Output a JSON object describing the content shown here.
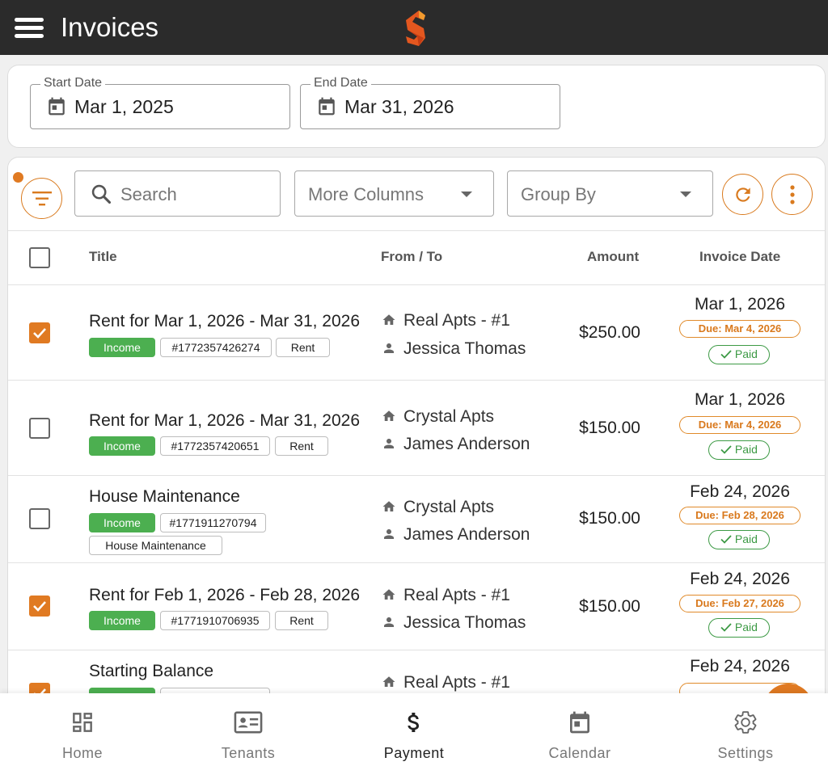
{
  "header": {
    "title": "Invoices"
  },
  "colors": {
    "accent": "#e07a22",
    "income": "#4caf50",
    "paid": "#3d9a45",
    "topbar": "#2b2b2b"
  },
  "date_range": {
    "start_label": "Start Date",
    "start_value": "Mar 1, 2025",
    "end_label": "End Date",
    "end_value": "Mar 31, 2026"
  },
  "toolbar": {
    "search_placeholder": "Search",
    "more_columns": "More Columns",
    "group_by": "Group By"
  },
  "table": {
    "columns": [
      "Title",
      "From / To",
      "Amount",
      "Invoice Date"
    ],
    "rows": [
      {
        "checked": true,
        "title": "Rent for Mar 1, 2026 - Mar 31, 2026",
        "tags": [
          "Income",
          "#1772357426274",
          "Rent"
        ],
        "property": "Real Apts - #1",
        "tenant": "Jessica Thomas",
        "amount": "$250.00",
        "invoice_date": "Mar 1, 2026",
        "due": "Due: Mar 4, 2026",
        "status": "Paid"
      },
      {
        "checked": false,
        "title": "Rent for Mar 1, 2026 - Mar 31, 2026",
        "tags": [
          "Income",
          "#1772357420651",
          "Rent"
        ],
        "property": "Crystal Apts",
        "tenant": "James Anderson",
        "amount": "$150.00",
        "invoice_date": "Mar 1, 2026",
        "due": "Due: Mar 4, 2026",
        "status": "Paid"
      },
      {
        "checked": false,
        "title": "House Maintenance",
        "tags": [
          "Income",
          "#1771911270794",
          "House Maintenance"
        ],
        "property": "Crystal Apts",
        "tenant": "James Anderson",
        "amount": "$150.00",
        "invoice_date": "Feb 24, 2026",
        "due": "Due: Feb 28, 2026",
        "status": "Paid"
      },
      {
        "checked": true,
        "title": "Rent for Feb 1, 2026 - Feb 28, 2026",
        "tags": [
          "Income",
          "#1771910706935",
          "Rent"
        ],
        "property": "Real Apts - #1",
        "tenant": "Jessica Thomas",
        "amount": "$150.00",
        "invoice_date": "Feb 24, 2026",
        "due": "Due: Feb 27, 2026",
        "status": "Paid"
      },
      {
        "checked": true,
        "title": "Starting Balance",
        "property": "Real Apts - #1",
        "invoice_date": "Feb 24, 2026"
      }
    ]
  },
  "bottom_nav": [
    {
      "label": "Home",
      "icon": "dashboard-icon",
      "active": false
    },
    {
      "label": "Tenants",
      "icon": "id-card-icon",
      "active": false
    },
    {
      "label": "Payment",
      "icon": "dollar-icon",
      "active": true
    },
    {
      "label": "Calendar",
      "icon": "calendar-icon",
      "active": false
    },
    {
      "label": "Settings",
      "icon": "gear-icon",
      "active": false
    }
  ]
}
